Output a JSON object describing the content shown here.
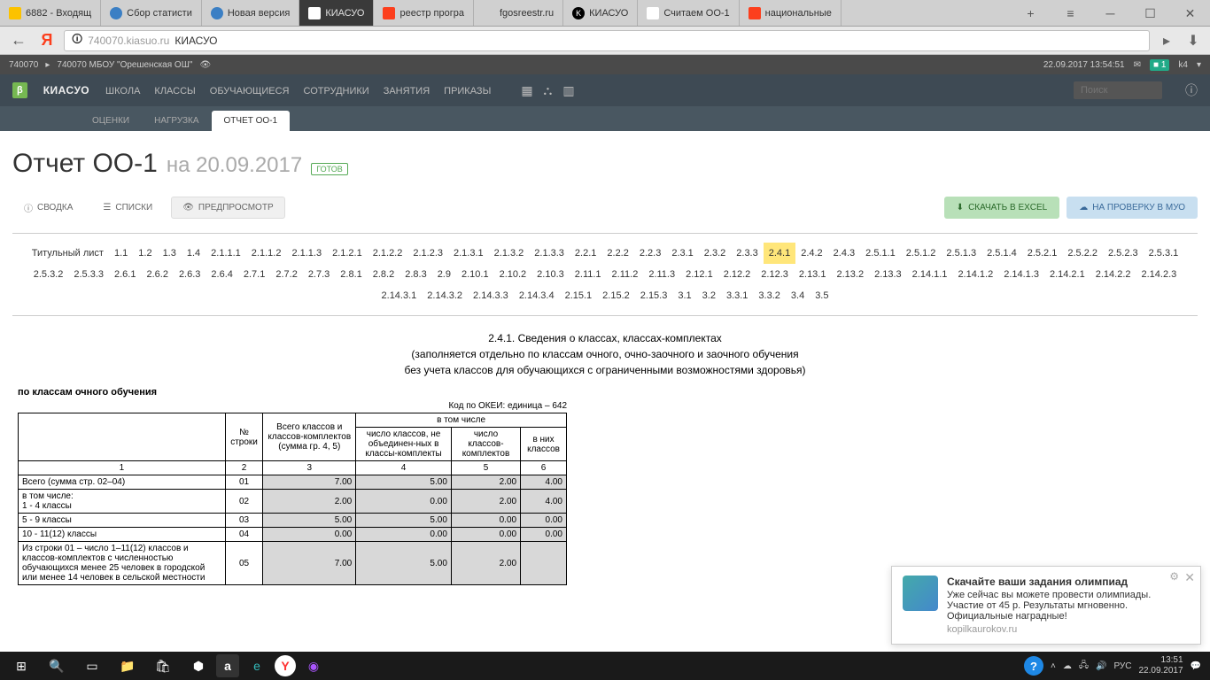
{
  "browser": {
    "tabs": [
      {
        "label": "6882 - Входящ",
        "icon": "mail"
      },
      {
        "label": "Сбор статисти",
        "icon": "globe"
      },
      {
        "label": "Новая версия",
        "icon": "globe"
      },
      {
        "label": "КИАСУО",
        "icon": "grad",
        "active": true
      },
      {
        "label": "реестр програ",
        "icon": "ya"
      },
      {
        "label": "fgosreestr.ru",
        "icon": ""
      },
      {
        "label": "КИАСУО",
        "icon": "k"
      },
      {
        "label": "Считаем ОО-1",
        "icon": "grad"
      },
      {
        "label": "национальные",
        "icon": "ya"
      }
    ],
    "url_domain": "740070.kiasuo.ru",
    "url_title": "КИАСУО"
  },
  "breadbar": {
    "school_code": "740070",
    "school_name": "740070 МБОУ \"Орешенская ОШ\"",
    "datetime": "22.09.2017 13:54:51",
    "user": "k4"
  },
  "nav": {
    "brand": "КИАСУО",
    "items": [
      "ШКОЛА",
      "КЛАССЫ",
      "ОБУЧАЮЩИЕСЯ",
      "СОТРУДНИКИ",
      "ЗАНЯТИЯ",
      "ПРИКАЗЫ"
    ],
    "search_placeholder": "Поиск"
  },
  "subtabs": {
    "items": [
      "ОЦЕНКИ",
      "НАГРУЗКА",
      "ОТЧЕТ ОО-1"
    ],
    "active": 2
  },
  "page": {
    "title": "Отчет ОО-1",
    "date_prefix": "на",
    "date": "20.09.2017",
    "status": "ГОТОВ",
    "views": {
      "summary": "СВОДКА",
      "lists": "СПИСКИ",
      "preview": "ПРЕДПРОСМОТР"
    },
    "export_excel": "СКАЧАТЬ В EXCEL",
    "export_send": "НА ПРОВЕРКУ В МУО"
  },
  "sections": {
    "active": "2.4.1",
    "items": [
      "Титульный лист",
      "1.1",
      "1.2",
      "1.3",
      "1.4",
      "2.1.1.1",
      "2.1.1.2",
      "2.1.1.3",
      "2.1.2.1",
      "2.1.2.2",
      "2.1.2.3",
      "2.1.3.1",
      "2.1.3.2",
      "2.1.3.3",
      "2.2.1",
      "2.2.2",
      "2.2.3",
      "2.3.1",
      "2.3.2",
      "2.3.3",
      "2.4.1",
      "2.4.2",
      "2.4.3",
      "2.5.1.1",
      "2.5.1.2",
      "2.5.1.3",
      "2.5.1.4",
      "2.5.2.1",
      "2.5.2.2",
      "2.5.2.3",
      "2.5.3.1",
      "2.5.3.2",
      "2.5.3.3",
      "2.6.1",
      "2.6.2",
      "2.6.3",
      "2.6.4",
      "2.7.1",
      "2.7.2",
      "2.7.3",
      "2.8.1",
      "2.8.2",
      "2.8.3",
      "2.9",
      "2.10.1",
      "2.10.2",
      "2.10.3",
      "2.11.1",
      "2.11.2",
      "2.11.3",
      "2.12.1",
      "2.12.2",
      "2.12.3",
      "2.13.1",
      "2.13.2",
      "2.13.3",
      "2.14.1.1",
      "2.14.1.2",
      "2.14.1.3",
      "2.14.2.1",
      "2.14.2.2",
      "2.14.2.3",
      "2.14.3.1",
      "2.14.3.2",
      "2.14.3.3",
      "2.14.3.4",
      "2.15.1",
      "2.15.2",
      "2.15.3",
      "3.1",
      "3.2",
      "3.3.1",
      "3.3.2",
      "3.4",
      "3.5"
    ]
  },
  "report": {
    "heading": "2.4.1. Сведения о классах, классах-комплектах",
    "sub1": "(заполняется отдельно по классам очного, очно-заочного и заочного обучения",
    "sub2": "без учета классов для обучающихся с ограниченными возможностями здоровья)",
    "form_label": "по классам очного обучения",
    "okei": "Код по ОКЕИ: единица – 642",
    "headers": {
      "col1": "№ строки",
      "col2": "Всего классов и классов-комплектов (сумма гр. 4, 5)",
      "group": "в том числе",
      "col3": "число классов, не объединен-ных в классы-комплекты",
      "col4": "число классов-комплектов",
      "col5": "в них классов",
      "nums": [
        "1",
        "2",
        "3",
        "4",
        "5",
        "6"
      ]
    },
    "rows": [
      {
        "label": "Всего (сумма стр. 02–04)",
        "code": "01",
        "v": [
          "7.00",
          "5.00",
          "2.00",
          "4.00"
        ]
      },
      {
        "label": "в том числе:\n1 - 4 классы",
        "code": "02",
        "v": [
          "2.00",
          "0.00",
          "2.00",
          "4.00"
        ]
      },
      {
        "label": "5 - 9 классы",
        "code": "03",
        "v": [
          "5.00",
          "5.00",
          "0.00",
          "0.00"
        ]
      },
      {
        "label": "10 - 11(12) классы",
        "code": "04",
        "v": [
          "0.00",
          "0.00",
          "0.00",
          "0.00"
        ]
      },
      {
        "label": "Из строки 01 – число 1–11(12) классов и классов-комплектов с численностью обучающихся менее 25 человек в городской или менее 14 человек в сельской местности",
        "code": "05",
        "v": [
          "7.00",
          "5.00",
          "2.00",
          ""
        ]
      }
    ]
  },
  "notification": {
    "title": "Скачайте ваши задания олимпиад",
    "body": "Уже сейчас вы можете провести олимпиады. Участие от 45 р. Результаты мгновенно. Официальные наградные!",
    "source": "kopilkaurokov.ru"
  },
  "taskbar": {
    "time": "13:51",
    "date": "22.09.2017",
    "lang": "РУС"
  }
}
